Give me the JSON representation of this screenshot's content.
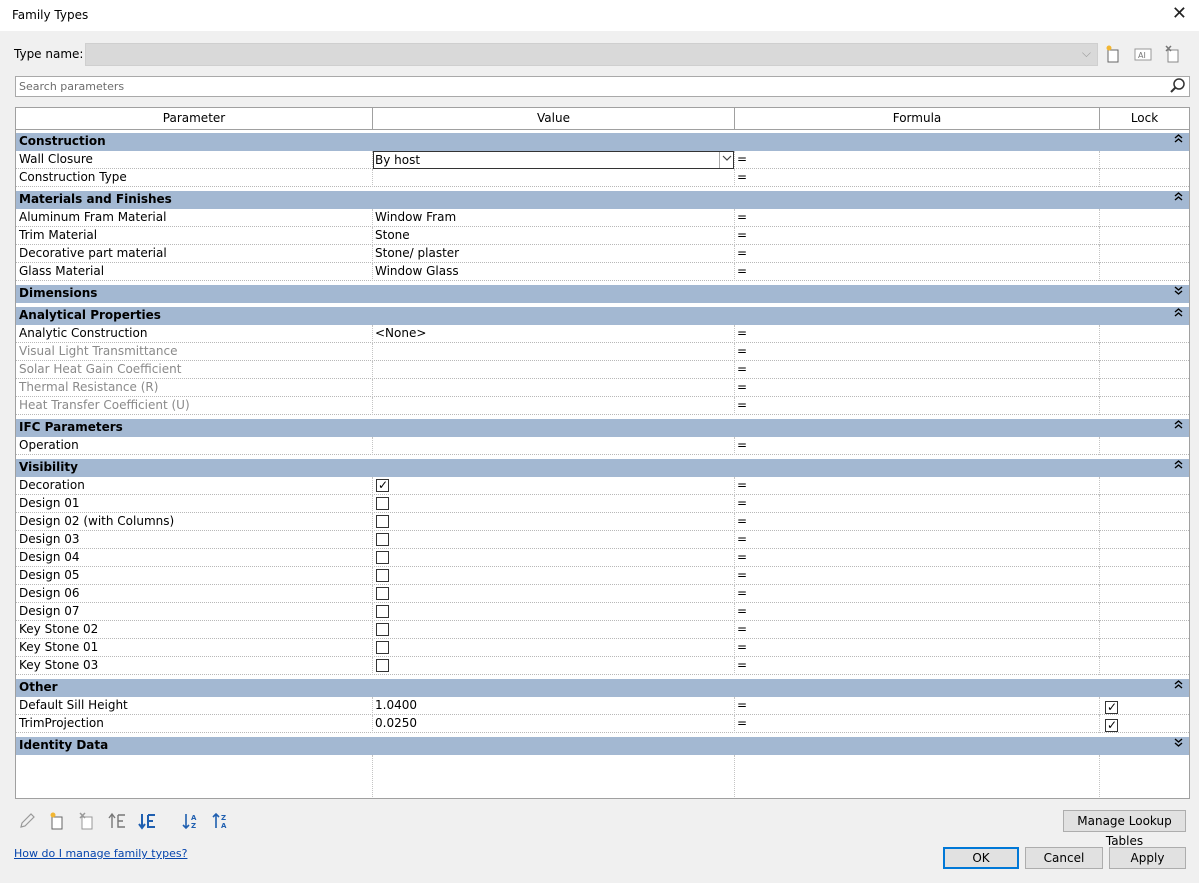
{
  "window": {
    "title": "Family Types",
    "close_glyph": "✕"
  },
  "type_name": {
    "label": "Type name:",
    "value": ""
  },
  "search": {
    "placeholder": "Search parameters"
  },
  "columns": {
    "parameter": "Parameter",
    "value": "Value",
    "formula": "Formula",
    "lock": "Lock"
  },
  "groups": [
    {
      "name": "Construction",
      "expanded": true,
      "rows": [
        {
          "param": "Wall Closure",
          "type": "dropdown",
          "value": "By host",
          "formula": "="
        },
        {
          "param": "Construction Type",
          "type": "text",
          "value": "",
          "formula": "="
        }
      ]
    },
    {
      "name": "Materials and Finishes",
      "expanded": true,
      "rows": [
        {
          "param": "Aluminum Fram Material",
          "type": "text",
          "value": "Window Fram",
          "formula": "="
        },
        {
          "param": "Trim Material",
          "type": "text",
          "value": "Stone",
          "formula": "="
        },
        {
          "param": "Decorative part material",
          "type": "text",
          "value": "Stone/ plaster",
          "formula": "="
        },
        {
          "param": "Glass Material",
          "type": "text",
          "value": "Window Glass",
          "formula": "="
        }
      ]
    },
    {
      "name": "Dimensions",
      "expanded": false,
      "rows": []
    },
    {
      "name": "Analytical Properties",
      "expanded": true,
      "rows": [
        {
          "param": "Analytic Construction",
          "type": "text",
          "value": "<None>",
          "formula": "="
        },
        {
          "param": "Visual Light Transmittance",
          "type": "text",
          "value": "",
          "formula": "=",
          "disabled": true
        },
        {
          "param": "Solar Heat Gain Coefficient",
          "type": "text",
          "value": "",
          "formula": "=",
          "disabled": true
        },
        {
          "param": "Thermal Resistance (R)",
          "type": "text",
          "value": "",
          "formula": "=",
          "disabled": true
        },
        {
          "param": "Heat Transfer Coefficient (U)",
          "type": "text",
          "value": "",
          "formula": "=",
          "disabled": true
        }
      ]
    },
    {
      "name": "IFC Parameters",
      "expanded": true,
      "rows": [
        {
          "param": "Operation",
          "type": "text",
          "value": "",
          "formula": "="
        }
      ]
    },
    {
      "name": "Visibility",
      "expanded": true,
      "rows": [
        {
          "param": "Decoration",
          "type": "checkbox",
          "checked": true,
          "formula": "="
        },
        {
          "param": "Design 01",
          "type": "checkbox",
          "checked": false,
          "formula": "="
        },
        {
          "param": "Design 02 (with Columns)",
          "type": "checkbox",
          "checked": false,
          "formula": "="
        },
        {
          "param": "Design 03",
          "type": "checkbox",
          "checked": false,
          "formula": "="
        },
        {
          "param": "Design 04",
          "type": "checkbox",
          "checked": false,
          "formula": "="
        },
        {
          "param": "Design 05",
          "type": "checkbox",
          "checked": false,
          "formula": "="
        },
        {
          "param": "Design 06",
          "type": "checkbox",
          "checked": false,
          "formula": "="
        },
        {
          "param": "Design 07",
          "type": "checkbox",
          "checked": false,
          "formula": "="
        },
        {
          "param": "Key Stone 02",
          "type": "checkbox",
          "checked": false,
          "formula": "="
        },
        {
          "param": "Key Stone 01",
          "type": "checkbox",
          "checked": false,
          "formula": "="
        },
        {
          "param": "Key Stone 03",
          "type": "checkbox",
          "checked": false,
          "formula": "="
        }
      ]
    },
    {
      "name": "Other",
      "expanded": true,
      "rows": [
        {
          "param": "Default Sill Height",
          "type": "text",
          "value": "1.0400",
          "formula": "=",
          "locked": true
        },
        {
          "param": "TrimProjection",
          "type": "text",
          "value": "0.0250",
          "formula": "=",
          "locked": true
        }
      ]
    },
    {
      "name": "Identity Data",
      "expanded": false,
      "rows": []
    }
  ],
  "buttons": {
    "manage_lookup": "Manage Lookup Tables",
    "ok": "OK",
    "cancel": "Cancel",
    "apply": "Apply"
  },
  "help_link": "How do I manage family types?",
  "icons": {
    "chevron_up": "up-chevron-icon",
    "chevron_down": "down-chevron-icon",
    "new_type": "new-type-icon",
    "rename_type": "rename-type-icon",
    "delete_type": "delete-type-icon"
  }
}
